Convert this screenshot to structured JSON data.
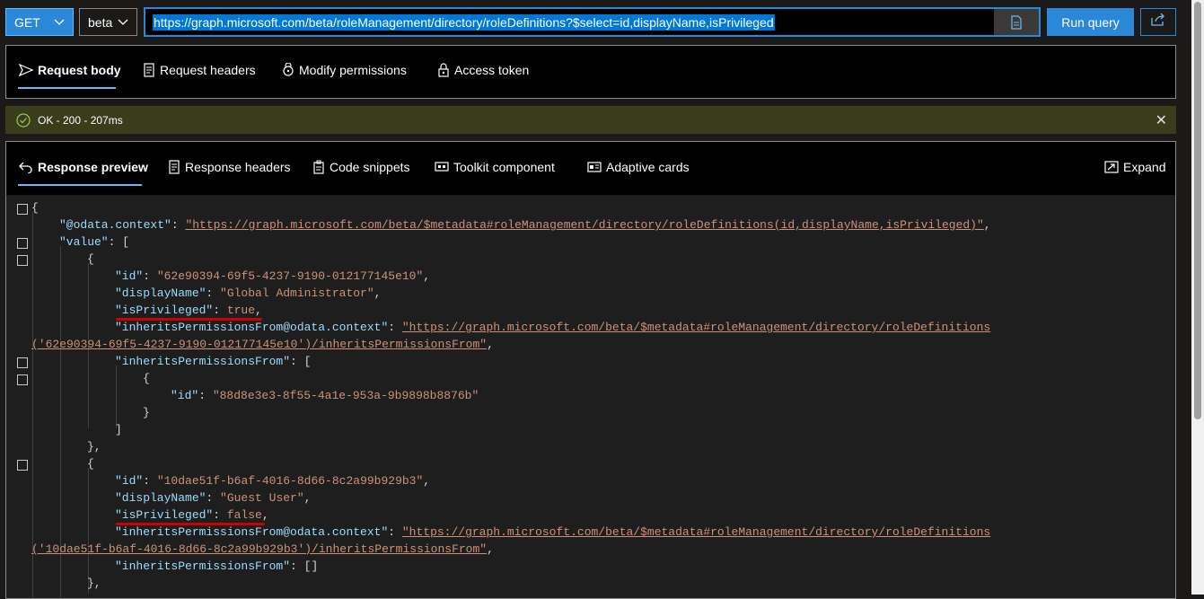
{
  "toolbar": {
    "method": "GET",
    "version": "beta",
    "url": "https://graph.microsoft.com/beta/roleManagement/directory/roleDefinitions?$select=id,displayName,isPrivileged",
    "run_label": "Run query"
  },
  "request_tabs": [
    "Request body",
    "Request headers",
    "Modify permissions",
    "Access token"
  ],
  "status": {
    "text": "OK - 200 - 207ms"
  },
  "response_tabs": [
    "Response preview",
    "Response headers",
    "Code snippets",
    "Toolkit component",
    "Adaptive cards"
  ],
  "expand_label": "Expand",
  "json": {
    "open_brace": "{",
    "k_context": "\"@odata.context\"",
    "v_context": "\"https://graph.microsoft.com/beta/$metadata#roleManagement/directory/roleDefinitions(id,displayName,isPrivileged)\"",
    "k_value": "\"value\"",
    "k_id": "\"id\"",
    "k_displayName": "\"displayName\"",
    "k_isPrivileged": "\"isPrivileged\"",
    "k_inheritsCtx": "\"inheritsPermissionsFrom@odata.context\"",
    "k_inherits": "\"inheritsPermissionsFrom\"",
    "ctx_prefix": "\"https://graph.microsoft.com/beta/$metadata#roleManagement/directory/roleDefinitions",
    "items": [
      {
        "id": "\"62e90394-69f5-4237-9190-012177145e10\"",
        "displayName": "\"Global Administrator\"",
        "isPrivileged": "true",
        "ctx_suffix": "('62e90394-69f5-4237-9190-012177145e10')/inheritsPermissionsFrom\"",
        "inherit_id": "\"88d8e3e3-8f55-4a1e-953a-9b9898b8876b\""
      },
      {
        "id": "\"10dae51f-b6af-4016-8d66-8c2a99b929b3\"",
        "displayName": "\"Guest User\"",
        "isPrivileged": "false",
        "ctx_suffix": "('10dae51f-b6af-4016-8d66-8c2a99b929b3')/inheritsPermissionsFrom\"",
        "inherits_value": "[]"
      }
    ]
  }
}
